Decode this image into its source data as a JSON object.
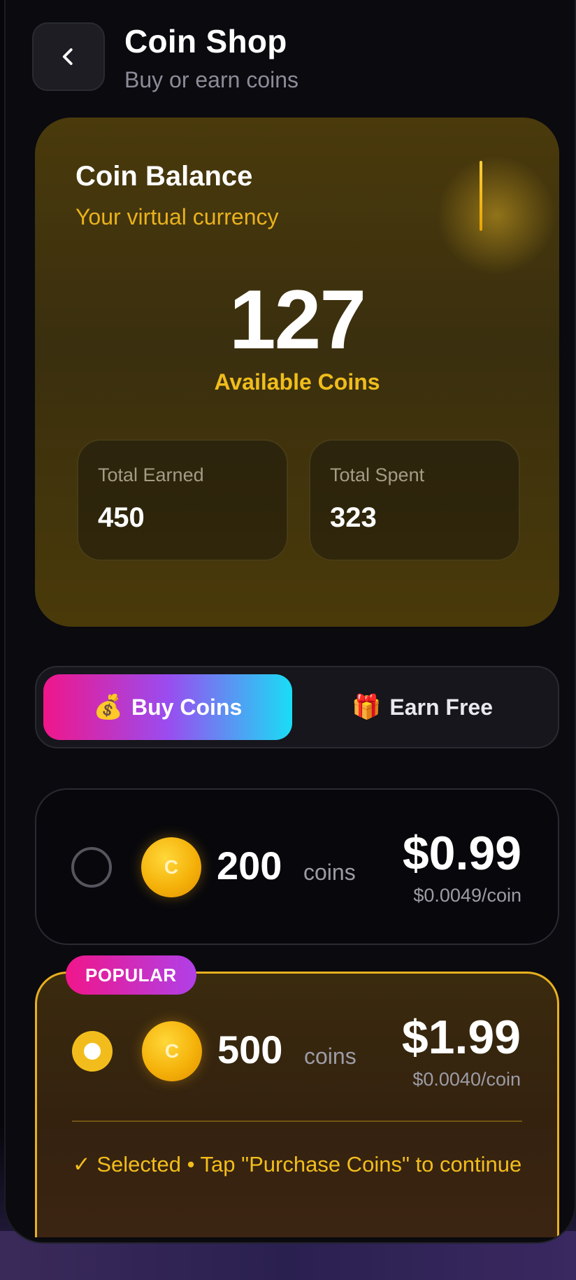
{
  "header": {
    "title": "Coin Shop",
    "subtitle": "Buy or earn coins"
  },
  "balance": {
    "title": "Coin Balance",
    "subtitle": "Your virtual currency",
    "amount": "127",
    "amount_label": "Available Coins",
    "stats": [
      {
        "label": "Total Earned",
        "value": "450"
      },
      {
        "label": "Total Spent",
        "value": "323"
      }
    ]
  },
  "tabs": [
    {
      "emoji": "💰",
      "label": "Buy Coins",
      "active": true
    },
    {
      "emoji": "🎁",
      "label": "Earn Free",
      "active": false
    }
  ],
  "packages": [
    {
      "coin_symbol": "C",
      "quantity": "200",
      "unit": "coins",
      "price": "$0.99",
      "per_coin": "$0.0049/coin",
      "selected": false
    },
    {
      "badge": "POPULAR",
      "coin_symbol": "C",
      "quantity": "500",
      "unit": "coins",
      "price": "$1.99",
      "per_coin": "$0.0040/coin",
      "selected": true,
      "note": "✓ Selected • Tap \"Purchase Coins\" to continue"
    }
  ],
  "colors": {
    "accent_gold": "#f2bd1c",
    "accent_pink": "#f0168a",
    "accent_cyan": "#19ddf5",
    "background": "#0a0a0f"
  },
  "icons": {
    "back": "chevron-left-icon",
    "coin": "coin-icon"
  }
}
